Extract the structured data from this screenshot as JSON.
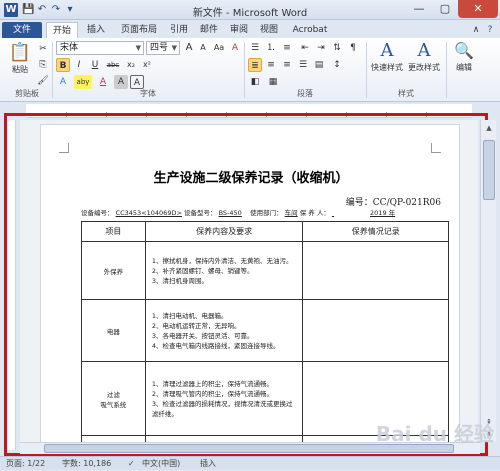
{
  "window": {
    "title": "新文件 - Microsoft Word",
    "minimize": "—",
    "maximize": "▢",
    "close": "✕"
  },
  "quick_access": [
    "save-icon",
    "undo-icon",
    "redo-icon",
    "customize-icon"
  ],
  "tabs": [
    {
      "label": "文件"
    },
    {
      "label": "开始"
    },
    {
      "label": "插入"
    },
    {
      "label": "页面布局"
    },
    {
      "label": "引用"
    },
    {
      "label": "邮件"
    },
    {
      "label": "审阅"
    },
    {
      "label": "视图"
    },
    {
      "label": "Acrobat"
    }
  ],
  "ribbon": {
    "clipboard": {
      "paste_label": "粘贴",
      "group_label": "剪贴板"
    },
    "font": {
      "font_name": "宋体",
      "font_size": "四号",
      "grow": "A",
      "shrink": "A",
      "case": "Aa",
      "clear": "A",
      "bold": "B",
      "italic": "I",
      "underline": "U",
      "strike": "abc",
      "subscript": "x₂",
      "superscript": "x²",
      "effects": "A",
      "highlight": "aby",
      "color": "A",
      "char_shading": "A",
      "char_border": "A",
      "group_label": "字体"
    },
    "paragraph": {
      "group_label": "段落"
    },
    "styles": {
      "quick_styles": "快速样式",
      "change_styles": "更改样式",
      "group_label": "样式"
    },
    "editing": {
      "edit_label": "编辑"
    }
  },
  "document": {
    "title": "生产设施二级保养记录（收缩机）",
    "number_label": "编号：CC/QP-021R06",
    "meta": {
      "equip_no_label": "设备编号：",
      "equip_no_value": "CC3453<104069D>",
      "model_label": "设备型号：",
      "model_value": "BS-450",
      "dept_label": "使用部门：",
      "dept_value": "车间",
      "maintainer_label": "保 养 人：",
      "year_value": "2019 年"
    },
    "table": {
      "headers": [
        "项目",
        "保养内容及要求",
        "保养情况记录"
      ],
      "rows": [
        {
          "item": "外保养",
          "requirements": [
            "1、擦拭机身，保持内外清洁、无黄袍、无油污。",
            "2、补齐紧固螺钉、螺母、销键等。",
            "3、清扫机身周围。"
          ]
        },
        {
          "item": "电器",
          "requirements": [
            "1、清扫电动机、电器箱。",
            "2、电动机运转正常，无异响。",
            "3、各电器开关、按钮灵活、可靠。",
            "4、检查电气箱内线路接线，紧固连接导线。"
          ]
        },
        {
          "item": "过滤\n吸气系统",
          "requirements": [
            "1、清理过滤器上的积尘，保持气流通畅。",
            "2、清理吸气管内的积尘，保持气流通畅。",
            "3、检查过滤器的损耗情况，视情况清洗或更换过滤纤维。"
          ]
        }
      ]
    }
  },
  "status": {
    "page": "页面: 1/22",
    "words": "字数: 10,186",
    "lang": "中文(中国)",
    "mode": "插入"
  },
  "watermark": "Bai du 经验"
}
